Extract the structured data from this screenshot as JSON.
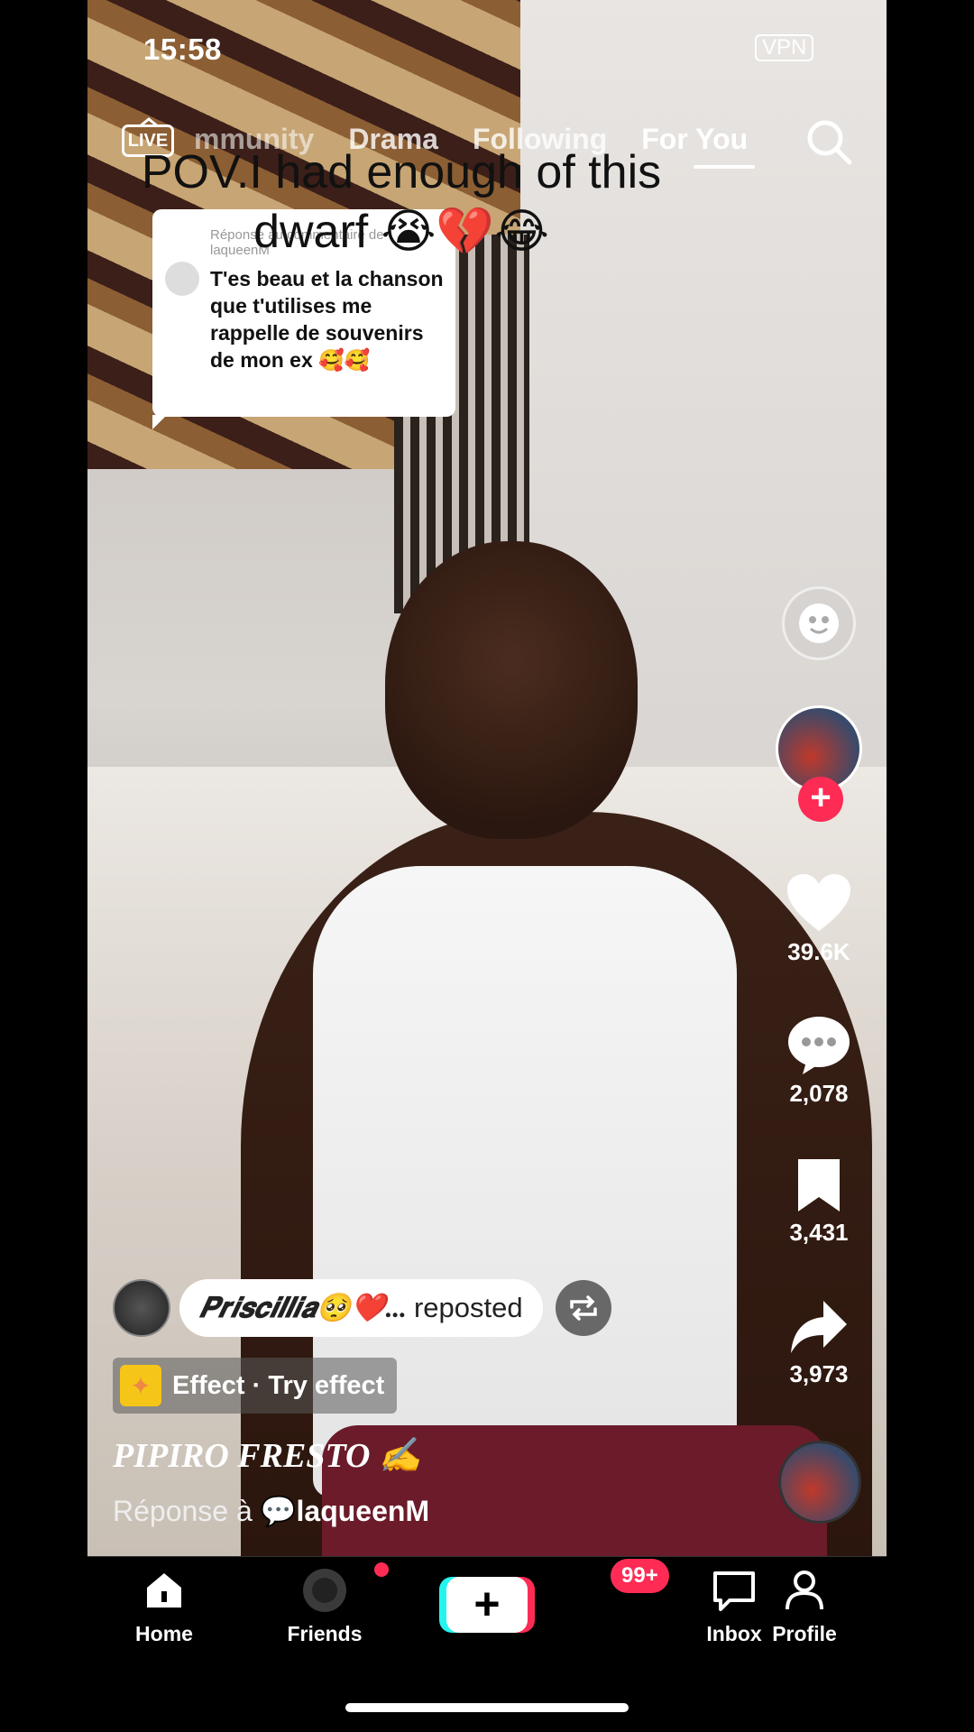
{
  "status_bar": {
    "time": "15:58",
    "vpn": "VPN"
  },
  "top_nav": {
    "live_label": "LIVE",
    "tabs": [
      {
        "label": "mmunity"
      },
      {
        "label": "Drama"
      },
      {
        "label": "Following"
      },
      {
        "label": "For You",
        "active": true
      }
    ]
  },
  "video": {
    "caption": "POV.I had enough of this dwarf 😭💔😂",
    "reply_sticker": {
      "header": "Réponse au commentaire de laqueenM",
      "text": "T'es beau et la chanson que t'utilises me rappelle de souvenirs de mon ex 🥰🥰"
    }
  },
  "actions": {
    "likes": "39.6K",
    "comments": "2,078",
    "saves": "3,431",
    "shares": "3,973"
  },
  "info": {
    "repost_name": "𝑷𝒓𝒊𝒔𝒄𝒊𝒍𝒍𝒊𝒂🥺❤️...",
    "repost_label": "reposted",
    "effect_label": "Effect · Try effect",
    "username": "PIPIRO FRESTO ✍️",
    "reply_prefix": "Réponse à",
    "reply_user": "💬laqueenM"
  },
  "bottom_nav": {
    "home": "Home",
    "friends": "Friends",
    "inbox": "Inbox",
    "inbox_badge": "99+",
    "profile": "Profile"
  },
  "colors": {
    "accent": "#fe2c55",
    "cyan": "#25f4ee"
  }
}
